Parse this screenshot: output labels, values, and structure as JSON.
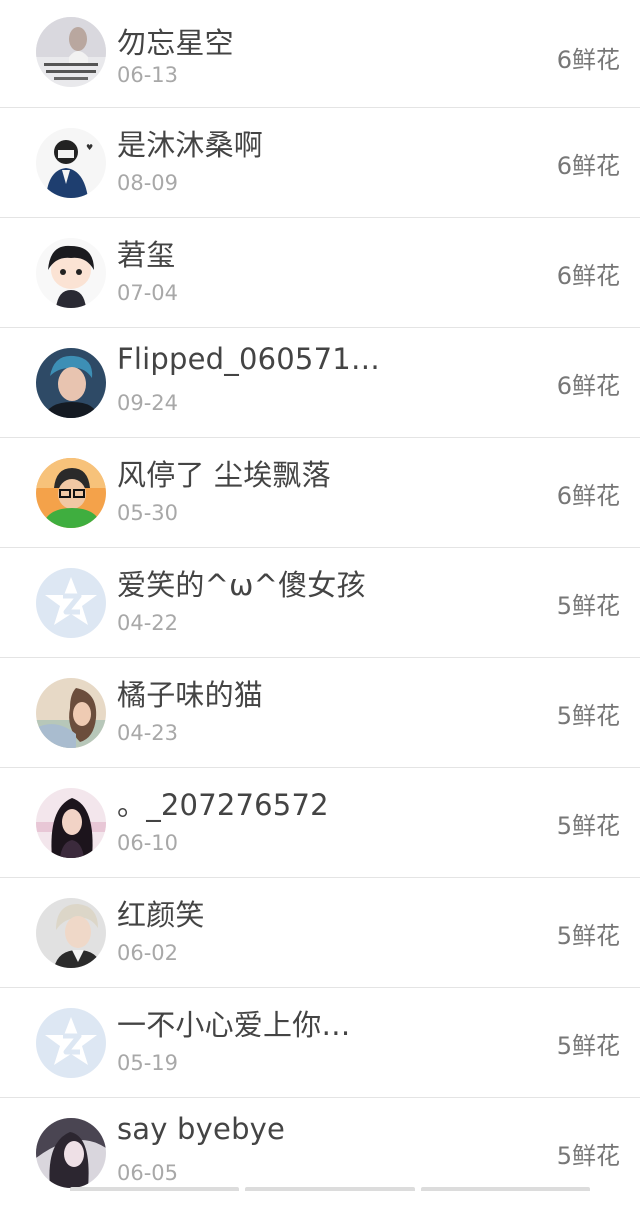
{
  "list": {
    "items": [
      {
        "name": "勿忘星空",
        "date": "06-13",
        "flowers": "6鲜花",
        "avatar": "photo-avatar-icon"
      },
      {
        "name": "是沐沐桑啊",
        "date": "08-09",
        "flowers": "6鲜花",
        "avatar": "photo-avatar-icon"
      },
      {
        "name": "莙玺",
        "date": "07-04",
        "flowers": "6鲜花",
        "avatar": "photo-avatar-icon"
      },
      {
        "name": "Flipped_060571…",
        "date": "09-24",
        "flowers": "6鲜花",
        "avatar": "photo-avatar-icon"
      },
      {
        "name": "风停了 尘埃飘落",
        "date": "05-30",
        "flowers": "6鲜花",
        "avatar": "photo-avatar-icon"
      },
      {
        "name": "爱笑的^ω^傻女孩",
        "date": "04-22",
        "flowers": "5鲜花",
        "avatar": "default-avatar-icon"
      },
      {
        "name": "橘子味的猫",
        "date": "04-23",
        "flowers": "5鲜花",
        "avatar": "photo-avatar-icon"
      },
      {
        "name": "。_207276572",
        "date": "06-10",
        "flowers": "5鲜花",
        "avatar": "photo-avatar-icon"
      },
      {
        "name": "红颜笑",
        "date": "06-02",
        "flowers": "5鲜花",
        "avatar": "photo-avatar-icon"
      },
      {
        "name": "一不小心爱上你…",
        "date": "05-19",
        "flowers": "5鲜花",
        "avatar": "default-avatar-icon"
      },
      {
        "name": "say byebye",
        "date": "06-05",
        "flowers": "5鲜花",
        "avatar": "photo-avatar-icon"
      }
    ]
  },
  "colors": {
    "name_text": "#444444",
    "date_text": "#a8a8a8",
    "flowers_text": "#777777",
    "divider": "#e4e4e4",
    "default_avatar_bg": "#dde7f3",
    "default_avatar_star": "#ffffff"
  }
}
